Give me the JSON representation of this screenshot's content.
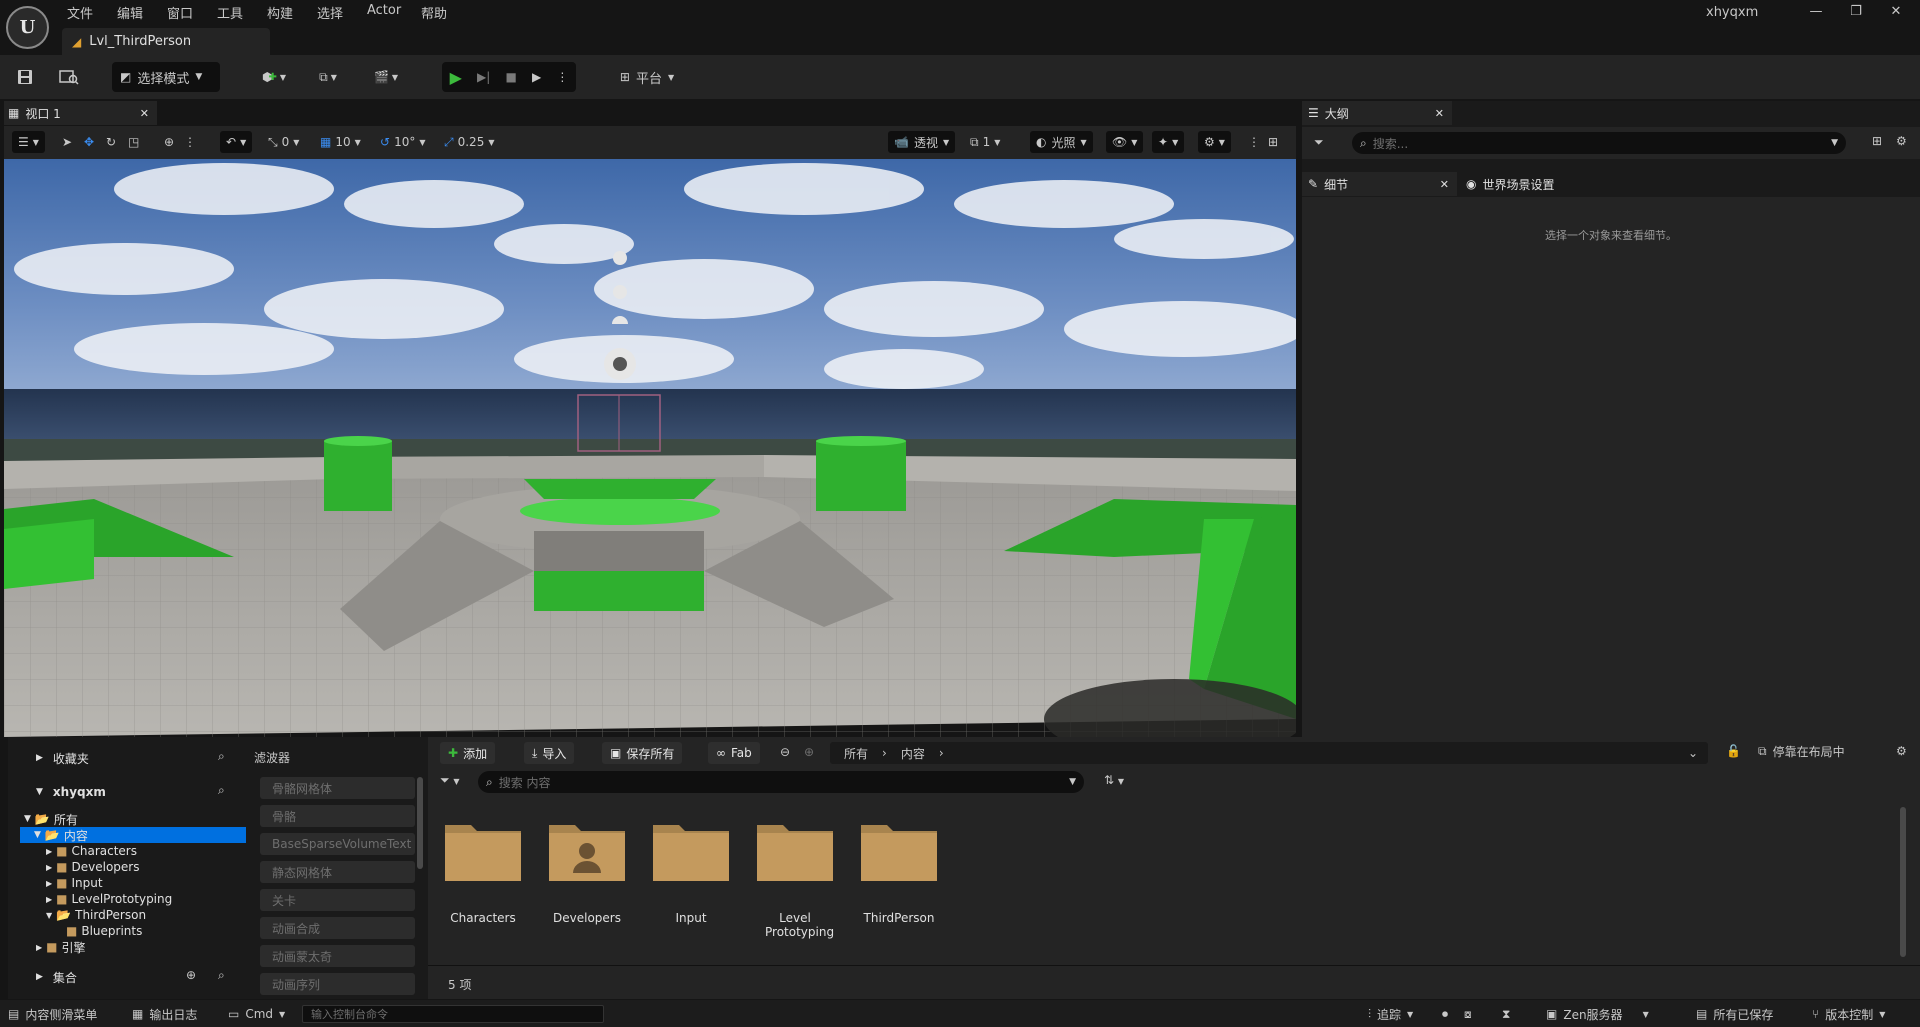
{
  "app": {
    "user": "xhyqxm",
    "level_tab": "Lvl_ThirdPerson"
  },
  "menu": [
    "文件",
    "编辑",
    "窗口",
    "工具",
    "构建",
    "选择",
    "Actor",
    "帮助"
  ],
  "toolbar": {
    "mode_label": "选择模式",
    "platform_label": "平台"
  },
  "viewport": {
    "tab_label": "视口 1",
    "snap_rot": "0",
    "grid_snap": "10",
    "rot_snap": "10°",
    "scale_snap": "0.25",
    "view_mode": "透视",
    "lighting": "光照",
    "speed": "1"
  },
  "outliner": {
    "title": "大纲",
    "search_placeholder": "搜索..."
  },
  "details": {
    "tab_label": "细节",
    "world_settings_label": "世界场景设置",
    "empty_message": "选择一个对象来查看细节。"
  },
  "content_browser": {
    "favorites": "收藏夹",
    "project": "xhyqxm",
    "tree": [
      "所有",
      "内容",
      "Characters",
      "Developers",
      "Input",
      "LevelPrototyping",
      "ThirdPerson",
      "Blueprints",
      "引擎"
    ],
    "collections": "集合",
    "filters_title": "滤波器",
    "filters": [
      "骨骼网格体",
      "骨骼",
      "BaseSparseVolumeText",
      "静态网格体",
      "关卡",
      "动画合成",
      "动画蒙太奇",
      "动画序列"
    ],
    "buttons": {
      "add": "添加",
      "import": "导入",
      "save_all": "保存所有",
      "fab": "Fab"
    },
    "breadcrumb": [
      "所有",
      "内容"
    ],
    "dock_label": "停靠在布局中",
    "search_placeholder": "搜索 内容",
    "assets": [
      "Characters",
      "Developers",
      "Input",
      "Level Prototyping",
      "ThirdPerson"
    ],
    "item_count": "5 项"
  },
  "statusbar": {
    "content_drawer": "内容侧滑菜单",
    "output_log": "输出日志",
    "cmd": "Cmd",
    "console_placeholder": "输入控制台命令",
    "trace": "追踪",
    "zen": "Zen服务器",
    "saved": "所有已保存",
    "source_control": "版本控制"
  },
  "colors": {
    "accent_green": "#3cba3c",
    "selection_blue": "#0070e0",
    "folder": "#c49a5e",
    "level_icon": "#e0a030"
  }
}
